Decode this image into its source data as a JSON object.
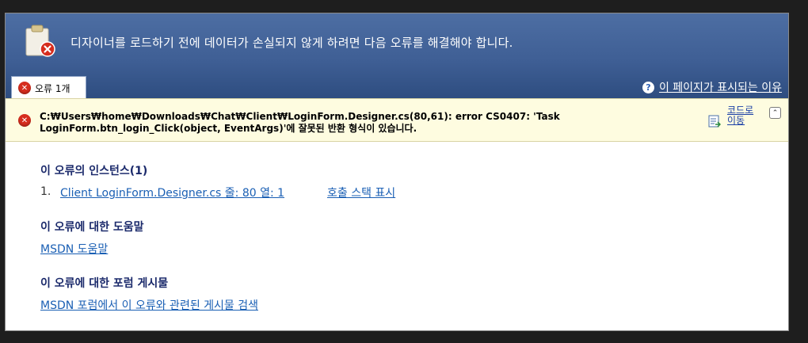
{
  "banner": {
    "title": "디자이너를 로드하기 전에 데이터가 손실되지 않게 하려면 다음 오류를 해결해야 합니다.",
    "icon": "clipboard-error-icon"
  },
  "tab": {
    "label": "오류 1개",
    "icon": "error-icon"
  },
  "help_link": {
    "label": "이 페이지가 표시되는 이유",
    "icon": "help-icon"
  },
  "error": {
    "message": "C:₩Users₩home₩Downloads₩Chat₩Client₩LoginForm.Designer.cs(80,61): error CS0407: 'Task LoginForm.btn_login_Click(object, EventArgs)'에 잘못된 반환 형식이 있습니다.",
    "code_link_label": "코드로 이동",
    "collapse_symbol": "⌃"
  },
  "instances": {
    "heading": "이 오류의 인스턴스(1)",
    "items": [
      {
        "index": "1.",
        "location": "Client LoginForm.Designer.cs 줄: 80 열: 1",
        "stack_label": "호출 스택 표시"
      }
    ]
  },
  "help": {
    "heading": "이 오류에 대한 도움말",
    "link": "MSDN 도움말"
  },
  "forum": {
    "heading": "이 오류에 대한 포럼 게시물",
    "link": "MSDN 포럼에서 이 오류와 관련된 게시물 검색"
  },
  "colors": {
    "banner": "#3f5f95",
    "error_row": "#fefce0",
    "link": "#1a5fb4",
    "heading": "#1b2a6b",
    "error_red": "#d62d1e"
  }
}
